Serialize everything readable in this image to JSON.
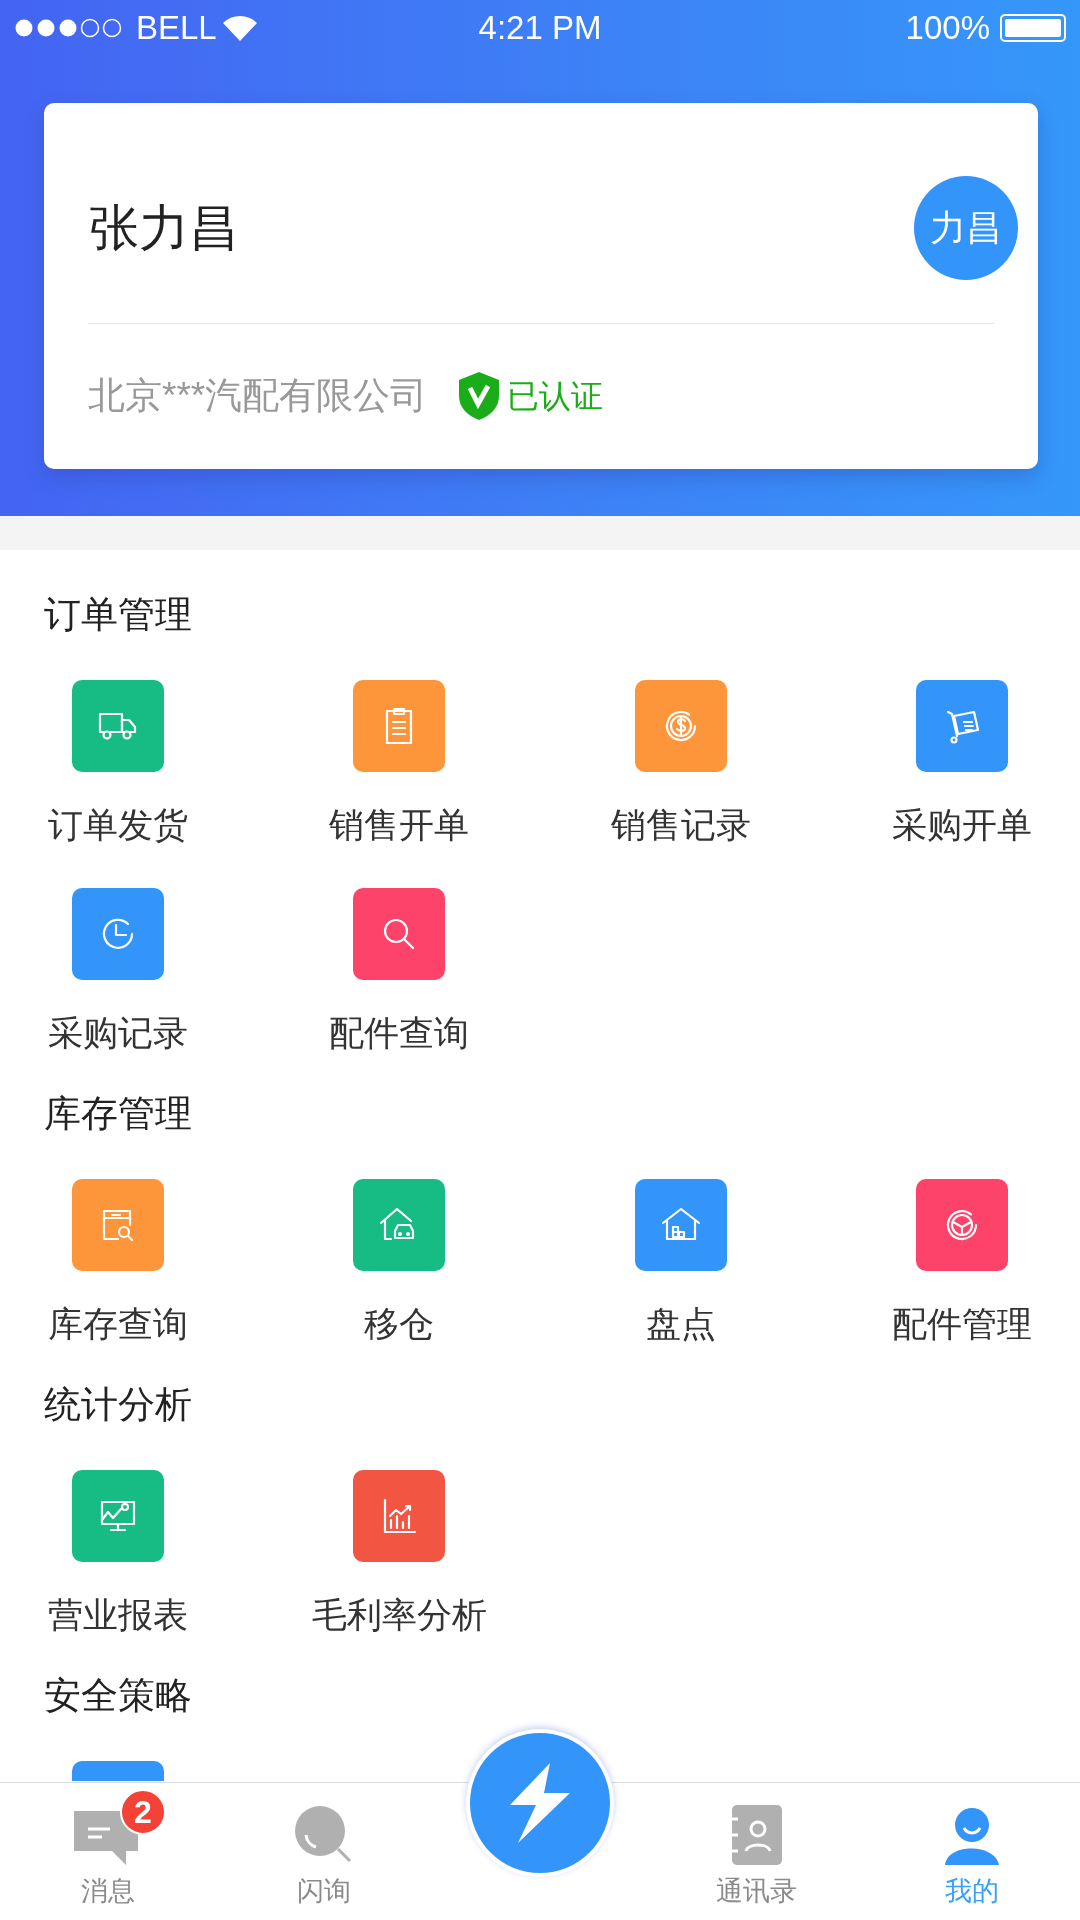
{
  "status_bar": {
    "carrier": "BELL",
    "time": "4:21 PM",
    "battery": "100%"
  },
  "profile": {
    "name": "张力昌",
    "avatar": "力昌",
    "company": "北京***汽配有限公司",
    "verified": true,
    "verified_label": "已认证"
  },
  "sections": [
    {
      "title": "订单管理",
      "items": [
        {
          "label": "订单发货",
          "color": "#17bb84"
        },
        {
          "label": "销售开单",
          "color": "#fd953b"
        },
        {
          "label": "销售记录",
          "color": "#fd953b"
        },
        {
          "label": "采购开单",
          "color": "#3394f9"
        },
        {
          "label": "采购记录",
          "color": "#3394f9"
        },
        {
          "label": "配件查询",
          "color": "#fd4369"
        }
      ]
    },
    {
      "title": "库存管理",
      "items": [
        {
          "label": "库存查询",
          "color": "#fd953b"
        },
        {
          "label": "移仓",
          "color": "#17bb84"
        },
        {
          "label": "盘点",
          "color": "#3394f9"
        },
        {
          "label": "配件管理",
          "color": "#fd4369"
        }
      ]
    },
    {
      "title": "统计分析",
      "items": [
        {
          "label": "营业报表",
          "color": "#17bb84"
        },
        {
          "label": "毛利率分析",
          "color": "#f25542"
        }
      ]
    },
    {
      "title": "安全策略",
      "items": [
        {
          "color": "#3394f9"
        }
      ]
    }
  ],
  "tab_bar": [
    {
      "label": "消息",
      "badge": "2",
      "selected": false
    },
    {
      "label": "闪询",
      "selected": false
    },
    {
      "kind": "action"
    },
    {
      "label": "通讯录",
      "selected": false
    },
    {
      "label": "我的",
      "selected": true
    }
  ]
}
